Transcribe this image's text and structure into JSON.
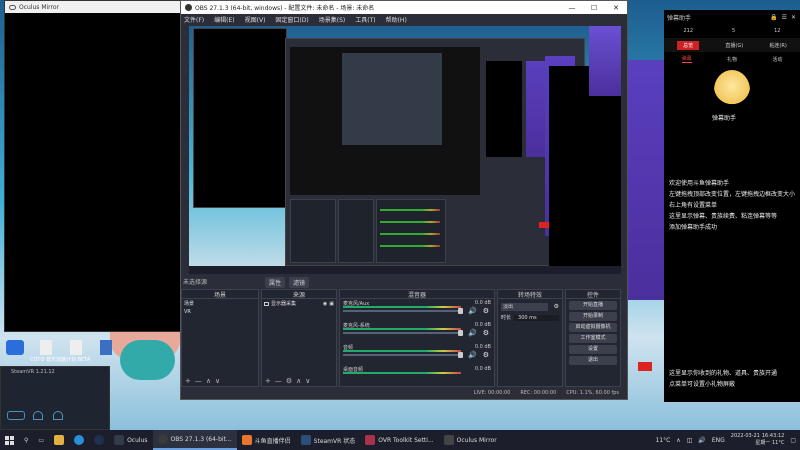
{
  "oculus_mirror": {
    "title": "Oculus Mirror"
  },
  "obs": {
    "title": "OBS 27.1.3 (64-bit, windows) - 配置文件: 未命名 - 场景: 未命名",
    "menu": [
      "文件(F)",
      "编辑(E)",
      "视图(V)",
      "固定窗口(D)",
      "场景集(S)",
      "工具(T)",
      "帮助(H)"
    ],
    "scene_status": "未选择源",
    "toolbar": [
      "属性",
      "滤镜"
    ],
    "docks": {
      "scenes": {
        "header": "场景",
        "items": [
          "场景",
          "VR"
        ]
      },
      "sources": {
        "header": "来源",
        "items": [
          "显示器采集"
        ]
      },
      "mixer": {
        "header": "混音器",
        "rows": [
          {
            "name": "麦克风/Aux",
            "db": "0.0 dB"
          },
          {
            "name": "麦克风-系统",
            "db": "0.0 dB"
          },
          {
            "name": "音频",
            "db": "0.0 dB"
          },
          {
            "name": "桌面音频",
            "db": "0.0 dB"
          }
        ]
      },
      "transitions": {
        "header": "转场特效",
        "type": "淡出",
        "duration_label": "时长",
        "duration": "300 ms"
      },
      "controls": {
        "header": "控件",
        "buttons": [
          "开始直播",
          "开始录制",
          "启动虚拟摄像机",
          "工作室模式",
          "设置",
          "退出"
        ]
      }
    },
    "statusbar": [
      "LIVE: 00:00:00",
      "REC: 00:00:00",
      "CPU: 1.1%, 60.00 fps"
    ]
  },
  "danmu": {
    "title": "弹幕助手",
    "stats": [
      "212",
      "5",
      "12"
    ],
    "tabs": [
      "总览",
      "直播(G)",
      "粘连(R)"
    ],
    "subtabs": [
      "弹幕",
      "礼物",
      "活动"
    ],
    "mascot_caption": "弹幕助手",
    "messages": [
      "欢迎使用斗鱼弹幕助手",
      "左键拖拽顶部改变位置，左键拖拽边框改变大小",
      "右上角有设置菜单",
      "这里显示弹幕、贵族续费、粘连弹幕等等",
      "添加弹幕助手成功"
    ],
    "messages2": [
      "这里显示你收到的礼物、道具、贵族开通",
      "点菜单可设置小礼物屏蔽"
    ]
  },
  "steamvr": {
    "title": "SteamVR 1.21.12"
  },
  "taskbar": {
    "items": [
      {
        "label": "Oculus",
        "color": "#333a48"
      },
      {
        "label": "OBS 27.1.3 (64-bit...",
        "color": "#3a3a3a"
      },
      {
        "label": "斗鱼直播伴侣",
        "color": "#e8762c"
      },
      {
        "label": "SteamVR 状态",
        "color": "#2b4f7a"
      },
      {
        "label": "OVR Toolkit Setti...",
        "color": "#a8324a"
      },
      {
        "label": "Oculus Mirror",
        "color": "#444"
      }
    ],
    "weather": "11°C",
    "lang": "ENG",
    "date": "2022-03-21",
    "time": "16:43:12",
    "day": "星期一 11°C"
  },
  "desktop_label": "COTO 音乐加速计划 BETA"
}
